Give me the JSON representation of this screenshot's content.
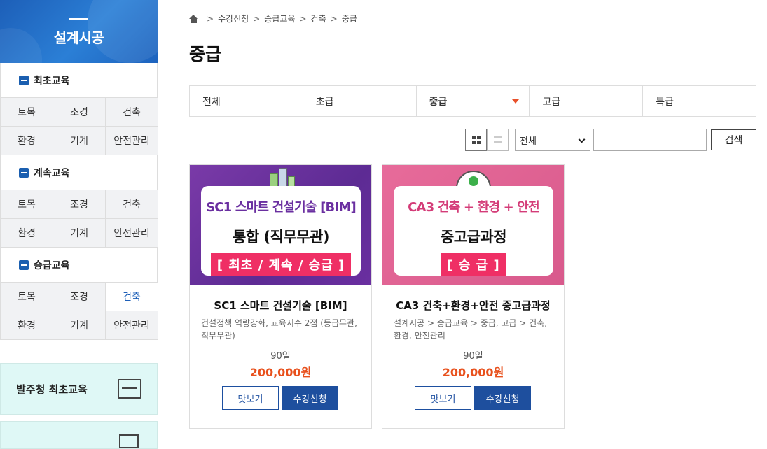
{
  "sidebar": {
    "title": "설계시공",
    "sections": [
      {
        "title": "최초교육",
        "items": [
          "토목",
          "조경",
          "건축",
          "환경",
          "기계",
          "안전관리"
        ]
      },
      {
        "title": "계속교육",
        "items": [
          "토목",
          "조경",
          "건축",
          "환경",
          "기계",
          "안전관리"
        ]
      },
      {
        "title": "승급교육",
        "items": [
          "토목",
          "조경",
          "건축",
          "환경",
          "기계",
          "안전관리"
        ],
        "active_item": "건축"
      }
    ],
    "promo": {
      "label": "발주청 최초교육"
    }
  },
  "breadcrumb": [
    "수강신청",
    "승급교육",
    "건축",
    "중급"
  ],
  "page_title": "중급",
  "tabs": [
    {
      "label": "전체"
    },
    {
      "label": "초급"
    },
    {
      "label": "중급",
      "active": true
    },
    {
      "label": "고급"
    },
    {
      "label": "특급"
    }
  ],
  "filter": {
    "select_value": "전체",
    "search_value": "",
    "search_button": "검색"
  },
  "courses": [
    {
      "banner_line1": "SC1 스마트 건설기술 [BIM]",
      "banner_line2": "통합 (직무무관)",
      "banner_line3": "[ 최초 / 계속 / 승급 ]",
      "title": "SC1 스마트 건설기술 [BIM]",
      "desc": "건설정책 역량강화, 교육지수 2점 (등급무관, 직무무관)",
      "days": "90일",
      "price": "200,000원",
      "preview_label": "맛보기",
      "apply_label": "수강신청"
    },
    {
      "banner_line1": "CA3 건축 + 환경 + 안전",
      "banner_line2": "중고급과정",
      "banner_line3": "[ 승 급 ]",
      "title": "CA3 건축+환경+안전 중고급과정",
      "desc": "설계시공 > 승급교육 > 중급, 고급 > 건축, 환경, 안전관리",
      "days": "90일",
      "price": "200,000원",
      "preview_label": "맛보기",
      "apply_label": "수강신청"
    }
  ]
}
